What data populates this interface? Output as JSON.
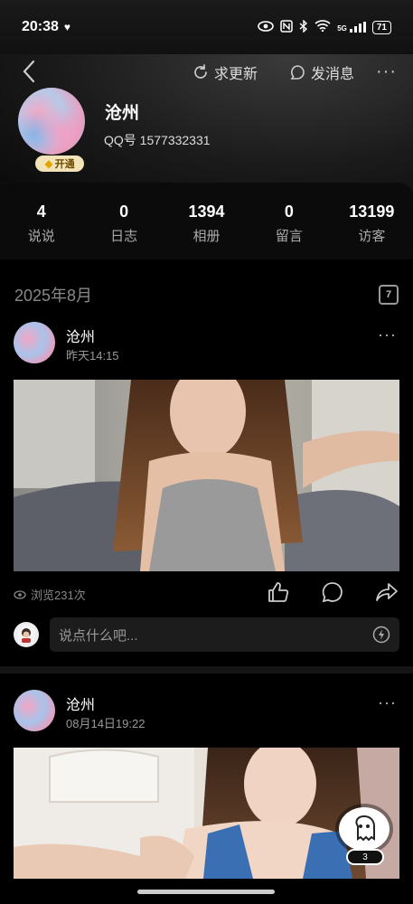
{
  "status": {
    "time": "20:38",
    "battery": "71",
    "network": "5G"
  },
  "nav": {
    "update_label": "求更新",
    "message_label": "发消息"
  },
  "profile": {
    "name": "沧州",
    "qq_id": "QQ号 1577332331",
    "vip_label": "开通"
  },
  "stats": [
    {
      "value": "4",
      "label": "说说"
    },
    {
      "value": "0",
      "label": "日志"
    },
    {
      "value": "1394",
      "label": "相册"
    },
    {
      "value": "0",
      "label": "留言"
    },
    {
      "value": "13199",
      "label": "访客"
    }
  ],
  "month": {
    "title": "2025年8月",
    "calendar_day": "7"
  },
  "posts": [
    {
      "author": "沧州",
      "time": "昨天14:15",
      "views": "浏览231次"
    },
    {
      "author": "沧州",
      "time": "08月14日19:22"
    }
  ],
  "comment": {
    "placeholder": "说点什么吧..."
  },
  "floating": {
    "count": "3"
  }
}
